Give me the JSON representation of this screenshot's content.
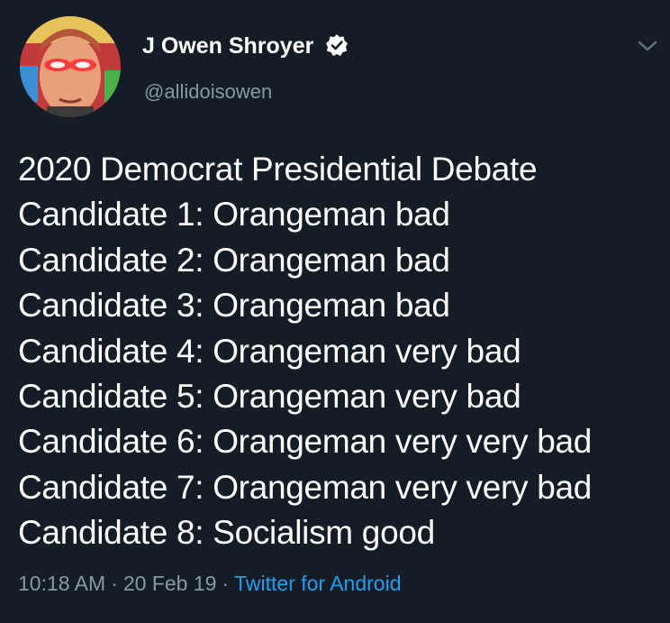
{
  "tweet": {
    "author": {
      "display_name": "J Owen Shroyer",
      "handle": "@allidoisowen",
      "verified": true
    },
    "lines": [
      "2020 Democrat Presidential Debate",
      "Candidate 1: Orangeman bad",
      "Candidate 2: Orangeman bad",
      "Candidate 3: Orangeman bad",
      "Candidate 4: Orangeman very bad",
      "Candidate 5: Orangeman very bad",
      "Candidate 6: Orangeman very very bad",
      "Candidate 7: Orangeman very very bad",
      "Candidate 8: Socialism good"
    ],
    "time": "10:18 AM",
    "date": "20 Feb 19",
    "separator": "·",
    "source": "Twitter for Android"
  },
  "colors": {
    "background": "#141d26",
    "text": "#ffffff",
    "secondary": "#8899a6",
    "link": "#1da1f2"
  },
  "icons": {
    "verified": "verified-badge-icon",
    "menu": "chevron-down-icon"
  }
}
